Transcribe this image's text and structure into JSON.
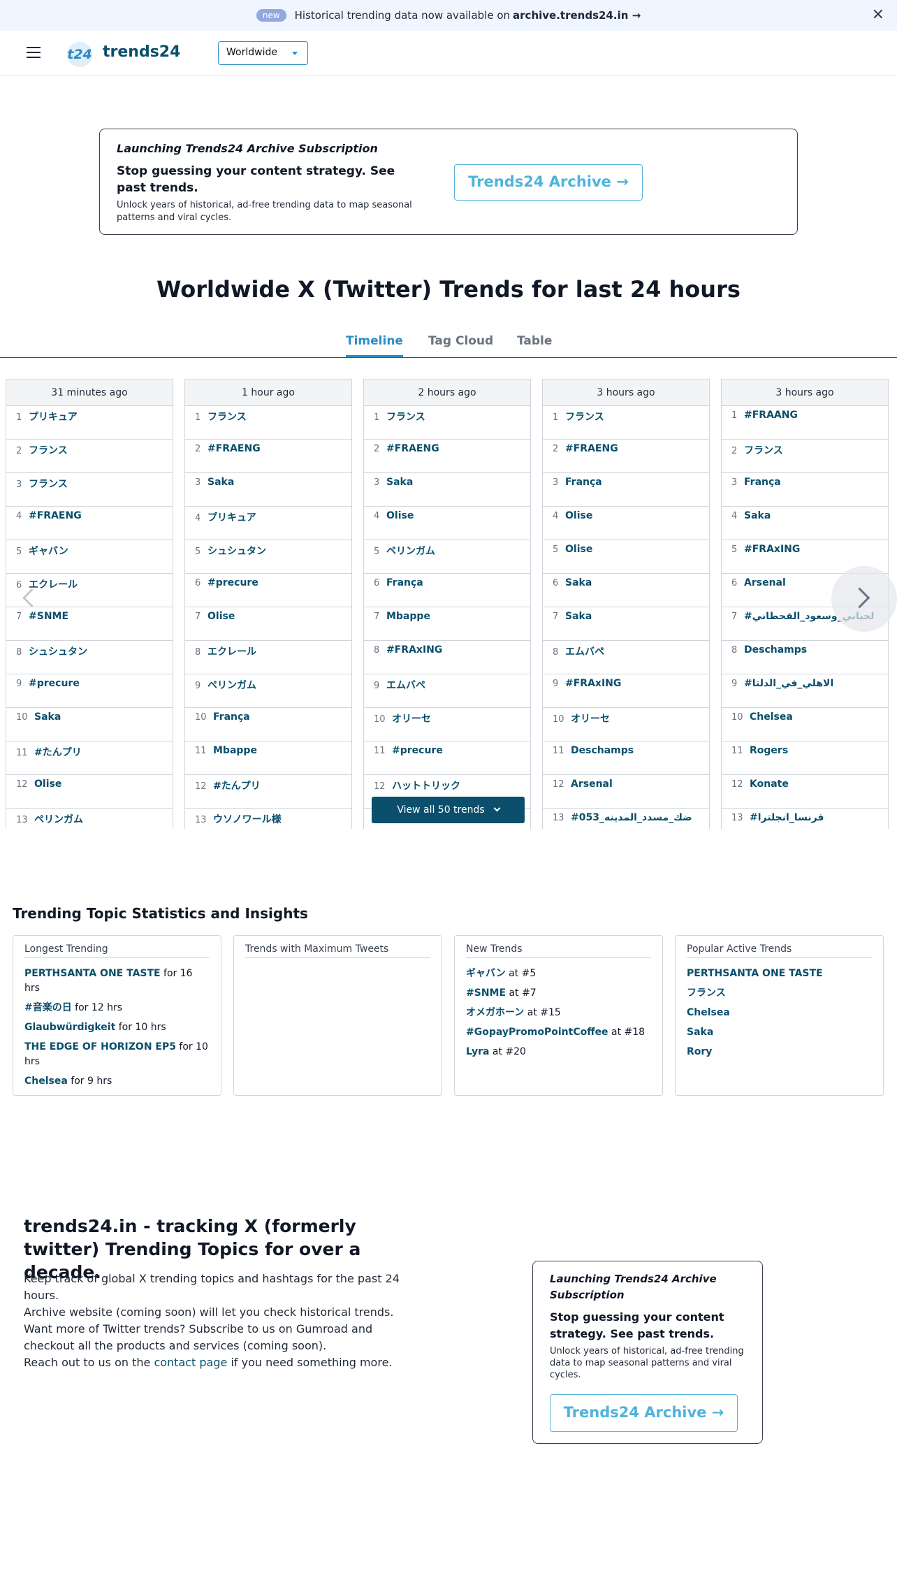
{
  "banner": {
    "badge": "new",
    "text": "Historical trending data now available on",
    "link": "archive.trends24.in →",
    "close": "×"
  },
  "header": {
    "logo_mark": "t24",
    "logo_text": "trends24",
    "region": "Worldwide"
  },
  "promo": {
    "title": "Launching Trends24 Archive Subscription",
    "headline": "Stop guessing your content strategy. See past trends.",
    "description": "Unlock years of historical, ad-free trending data to map seasonal patterns and viral cycles.",
    "button": "Trends24 Archive →"
  },
  "main": {
    "title": "Worldwide X (Twitter) Trends for last 24 hours",
    "tabs": [
      "Timeline",
      "Tag Cloud",
      "Table"
    ],
    "view_all": "View all 50 trends"
  },
  "timeline": [
    {
      "time": "31 minutes ago",
      "trends": [
        "プリキュア",
        "フランス",
        "フランス",
        "#FRAENG",
        "ギャバン",
        "エクレール",
        "#SNME",
        "シュシュタン",
        "#precure",
        "Saka",
        "#たんプリ",
        "Olise",
        "ペリンガム"
      ]
    },
    {
      "time": "1 hour ago",
      "trends": [
        "フランス",
        "#FRAENG",
        "Saka",
        "プリキュア",
        "シュシュタン",
        "#precure",
        "Olise",
        "エクレール",
        "ペリンガム",
        "França",
        "Mbappe",
        "#たんプリ",
        "ウソノワール様"
      ]
    },
    {
      "time": "2 hours ago",
      "trends": [
        "フランス",
        "#FRAENG",
        "Saka",
        "Olise",
        "ペリンガム",
        "França",
        "Mbappe",
        "#FRAxING",
        "エムバペ",
        "オリーセ",
        "#precure",
        "ハットトリック",
        ""
      ]
    },
    {
      "time": "3 hours ago",
      "trends": [
        "フランス",
        "#FRAENG",
        "França",
        "Olise",
        "Olise",
        "Saka",
        "Saka",
        "エムバペ",
        "#FRAxING",
        "オリーセ",
        "Deschamps",
        "Arsenal",
        "#053_ضك_مسدد_المدينه"
      ]
    },
    {
      "time": "3 hours ago",
      "trends": [
        "#FRAANG",
        "フランス",
        "França",
        "Saka",
        "#FRAxING",
        "Arsenal",
        "#لحياني_وسعود_القحطاني",
        "Deschamps",
        "#الاهلي_في_الدلتا",
        "Chelsea",
        "Rogers",
        "Konate",
        "#فرنسا_انجلترا"
      ]
    }
  ],
  "stats": {
    "title": "Trending Topic Statistics and Insights",
    "cards": [
      {
        "title": "Longest Trending",
        "items": [
          {
            "name": "PERTHSANTA ONE TASTE",
            "suffix": " for 16 hrs"
          },
          {
            "name": "#音楽の日",
            "suffix": " for 12 hrs"
          },
          {
            "name": "Glaubwürdigkeit",
            "suffix": " for 10 hrs"
          },
          {
            "name": "THE EDGE OF HORIZON EP5",
            "suffix": " for 10 hrs"
          },
          {
            "name": "Chelsea",
            "suffix": " for 9 hrs"
          }
        ]
      },
      {
        "title": "Trends with Maximum Tweets",
        "items": []
      },
      {
        "title": "New Trends",
        "items": [
          {
            "name": "ギャバン",
            "suffix": " at #5"
          },
          {
            "name": "#SNME",
            "suffix": " at #7"
          },
          {
            "name": "オメガホーン",
            "suffix": " at #15"
          },
          {
            "name": "#GopayPromoPointCoffee",
            "suffix": " at #18"
          },
          {
            "name": "Lyra",
            "suffix": " at #20"
          }
        ]
      },
      {
        "title": "Popular Active Trends",
        "items": [
          {
            "name": "PERTHSANTA ONE TASTE",
            "suffix": ""
          },
          {
            "name": "フランス",
            "suffix": ""
          },
          {
            "name": "Chelsea",
            "suffix": ""
          },
          {
            "name": "Saka",
            "suffix": ""
          },
          {
            "name": "Rory",
            "suffix": ""
          }
        ]
      }
    ]
  },
  "about": {
    "title": "trends24.in - tracking X (formerly twitter) Trending Topics for over a decade.",
    "p1": "Keep track of global X trending topics and hashtags for the past 24 hours.",
    "p2": "Archive website (coming soon) will let you check historical trends.",
    "p3": "Want more of Twitter trends? Subscribe to us on Gumroad and checkout all the products and services (coming soon).",
    "p4_before": "Reach out to us on the ",
    "p4_link": "contact page",
    "p4_after": " if you need something more."
  }
}
